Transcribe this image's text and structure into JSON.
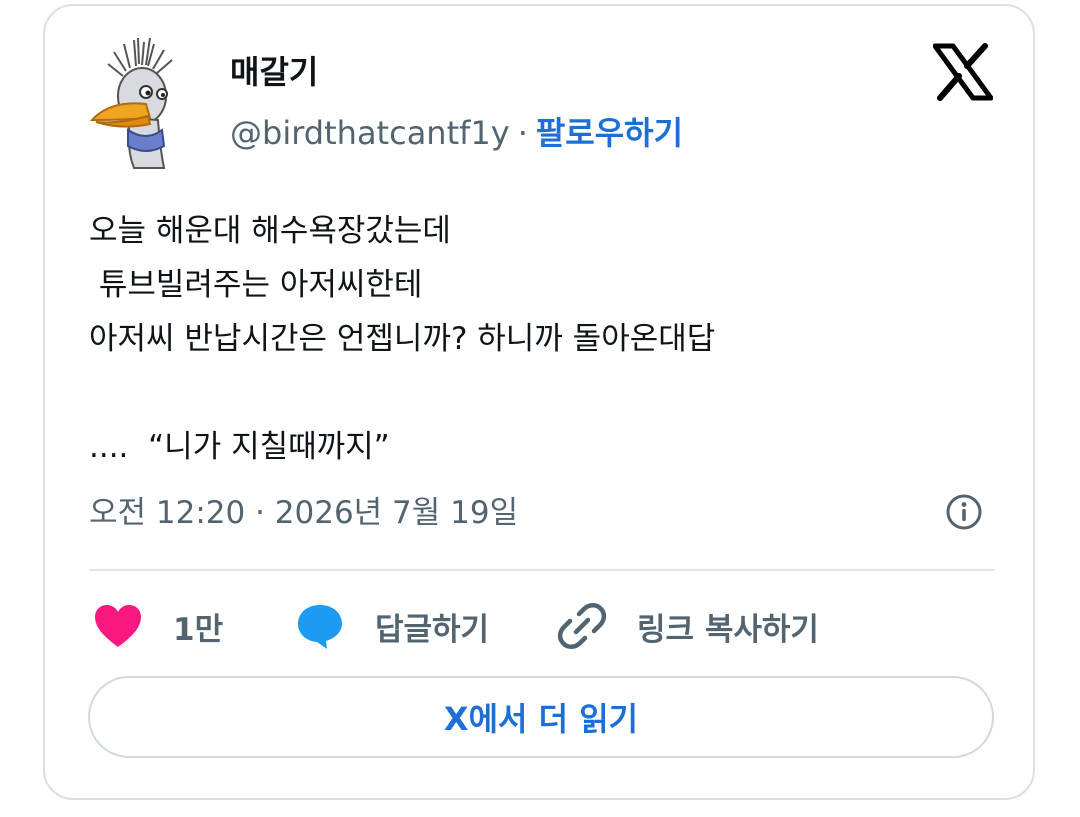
{
  "author": {
    "display_name": "매갈기",
    "handle": "@birdthatcantf1y",
    "separator": "·",
    "follow_label": "팔로우하기"
  },
  "tweet": {
    "text": "오늘 해운대 해수욕장갔는데\n 튜브빌려주는 아저씨한테\n아저씨 반납시간은 언젭니까? 하니까 돌아온대답\n\n....  “니가 지칠때까지”",
    "timestamp": "오전 12:20 · 2026년 7월 19일"
  },
  "actions": {
    "like_count": "1만",
    "reply_label": "답글하기",
    "copy_link_label": "링크 복사하기"
  },
  "read_more_label": "X에서 더 읽기",
  "icons": {
    "avatar": "bird-avatar-icon",
    "brand": "x-logo-icon",
    "info": "info-icon",
    "like": "heart-icon",
    "reply": "speech-bubble-icon",
    "copy": "link-icon"
  },
  "colors": {
    "heart": "#f91880",
    "reply_bubble": "#1d9bf0",
    "link_blue": "#1d6fd6",
    "muted_text": "#536471",
    "primary_text": "#0f1419",
    "border": "#dcdfe3"
  }
}
